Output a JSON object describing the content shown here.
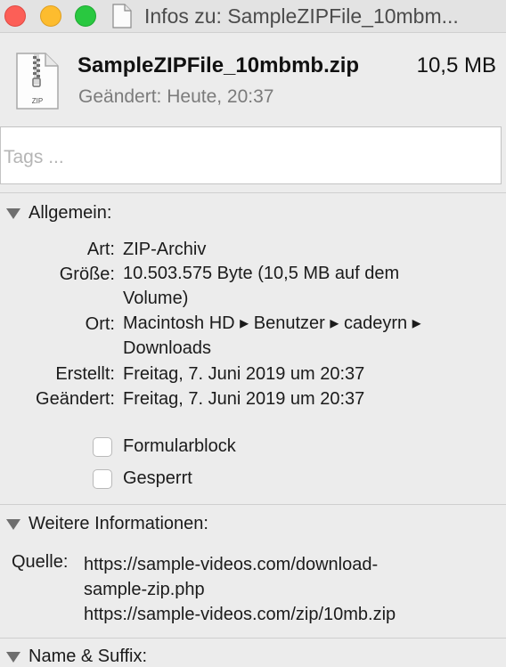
{
  "window": {
    "title": "Infos zu: SampleZIPFile_10mbm..."
  },
  "file": {
    "name": "SampleZIPFile_10mbmb.zip",
    "size": "10,5 MB",
    "modified": "Geändert: Heute, 20:37",
    "icon_text": "ZIP"
  },
  "tags": {
    "placeholder": "Tags ..."
  },
  "general": {
    "header": "Allgemein:",
    "rows": {
      "kind": {
        "label": "Art:",
        "value": "ZIP-Archiv"
      },
      "size": {
        "label": "Größe:",
        "value": "10.503.575 Byte (10,5 MB auf dem Volume)"
      },
      "where": {
        "label": "Ort:",
        "value": "Macintosh HD ▸ Benutzer ▸ cadeyrn ▸ Downloads"
      },
      "created": {
        "label": "Erstellt:",
        "value": "Freitag, 7. Juni 2019 um 20:37"
      },
      "modified": {
        "label": "Geändert:",
        "value": "Freitag, 7. Juni 2019 um 20:37"
      }
    },
    "checkboxes": {
      "stationery": {
        "label": "Formularblock",
        "checked": false
      },
      "locked": {
        "label": "Gesperrt",
        "checked": false
      }
    }
  },
  "more_info": {
    "header": "Weitere Informationen:",
    "source_label": "Quelle:",
    "source_lines": [
      "https://sample-videos.com/download-",
      "sample-zip.php",
      "https://sample-videos.com/zip/10mb.zip"
    ]
  },
  "name_extension": {
    "header": "Name & Suffix:"
  },
  "colors": {
    "close": "#fc5f57",
    "minimize": "#fdbc2e",
    "zoom": "#29c840",
    "background": "#ececec"
  },
  "icons": [
    "document-icon",
    "zip-file-icon",
    "disclosure-triangle-icon"
  ]
}
